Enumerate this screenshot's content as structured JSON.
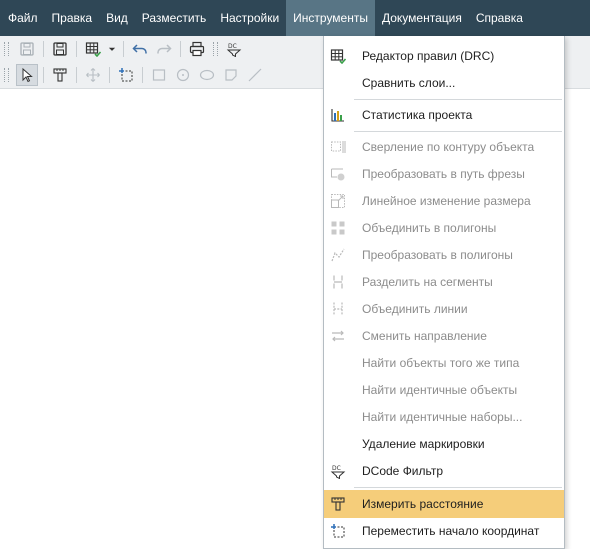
{
  "menubar": {
    "items": [
      "Файл",
      "Правка",
      "Вид",
      "Разместить",
      "Настройки",
      "Инструменты",
      "Документация",
      "Справка"
    ],
    "active": "Инструменты"
  },
  "toolbar": {
    "row1_icons": [
      "save-icon",
      "save-all-icon",
      "grid-icon",
      "undo-icon",
      "redo-icon",
      "print-icon",
      "dcode-icon"
    ],
    "row2_icons": [
      "select-arrow-icon",
      "measure-icon",
      "move-icon",
      "origin-icon",
      "rect-icon",
      "circle-icon",
      "ellipse-icon",
      "polygon-icon"
    ]
  },
  "menu": {
    "items": [
      {
        "label": "Редактор правил (DRC)",
        "icon": "drc-icon",
        "enabled": true
      },
      {
        "label": "Сравнить слои...",
        "icon": "",
        "enabled": true
      },
      {
        "label": "Статистика проекта",
        "icon": "bar-chart-icon",
        "enabled": true
      },
      {
        "label": "Сверление по контуру объекта",
        "icon": "drill-icon",
        "enabled": false
      },
      {
        "label": "Преобразовать в путь фрезы",
        "icon": "mill-path-icon",
        "enabled": false
      },
      {
        "label": "Линейное изменение размера",
        "icon": "resize-icon",
        "enabled": false
      },
      {
        "label": "Объединить в полигоны",
        "icon": "merge-polygons-icon",
        "enabled": false
      },
      {
        "label": "Преобразовать в полигоны",
        "icon": "convert-polygons-icon",
        "enabled": false
      },
      {
        "label": "Разделить на сегменты",
        "icon": "split-segments-icon",
        "enabled": false
      },
      {
        "label": "Объединить линии",
        "icon": "join-lines-icon",
        "enabled": false
      },
      {
        "label": "Сменить направление",
        "icon": "reverse-direction-icon",
        "enabled": false
      },
      {
        "label": "Найти объекты того же типа",
        "icon": "",
        "enabled": false
      },
      {
        "label": "Найти идентичные объекты",
        "icon": "",
        "enabled": false
      },
      {
        "label": "Найти идентичные наборы...",
        "icon": "",
        "enabled": false
      },
      {
        "label": "Удаление маркировки",
        "icon": "",
        "enabled": true
      },
      {
        "label": "DCode Фильтр",
        "icon": "dcode-filter-icon",
        "enabled": true
      },
      {
        "label": "Измерить расстояние",
        "icon": "measure-distance-icon",
        "enabled": true,
        "highlighted": true
      },
      {
        "label": "Переместить начало координат",
        "icon": "move-origin-icon",
        "enabled": true
      }
    ]
  },
  "colors": {
    "menubar_bg": "#2f4756",
    "menubar_active": "#587585",
    "highlight": "#f5cd7a"
  }
}
